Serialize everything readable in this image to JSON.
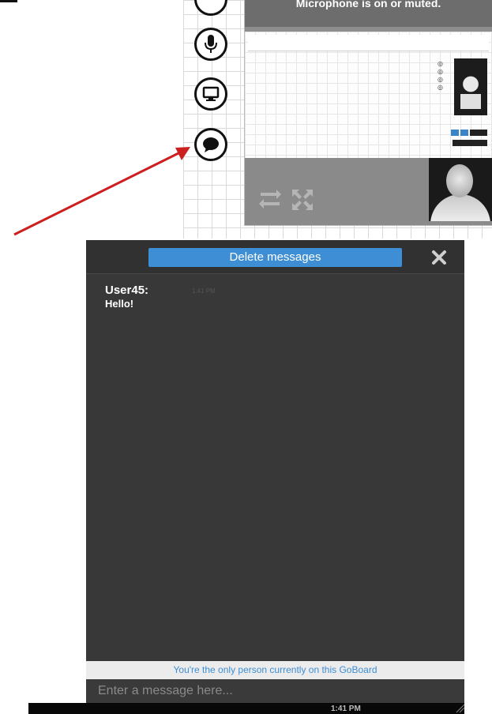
{
  "top_screenshot": {
    "video_title": "Microphone is on or muted.",
    "toolbar_buttons": [
      {
        "name": "microphone",
        "icon": "microphone-icon"
      },
      {
        "name": "screen-share",
        "icon": "monitor-icon"
      },
      {
        "name": "chat",
        "icon": "chat-bubble-icon"
      }
    ],
    "video_controls": [
      "swap-icon",
      "fullscreen-icon"
    ],
    "arrow_color": "#cc1f1f"
  },
  "chat": {
    "delete_button_label": "Delete messages",
    "close_icon": "close-icon",
    "messages": [
      {
        "user": "User45:",
        "time": "1:41 PM",
        "text": "Hello!"
      }
    ],
    "notice": "You're the only person currently on this GoBoard",
    "input_placeholder": "Enter a message here...",
    "accent_color": "#3d8ed4",
    "background_color": "#383838"
  },
  "bottom_bar": {
    "time": "1:41 PM"
  }
}
